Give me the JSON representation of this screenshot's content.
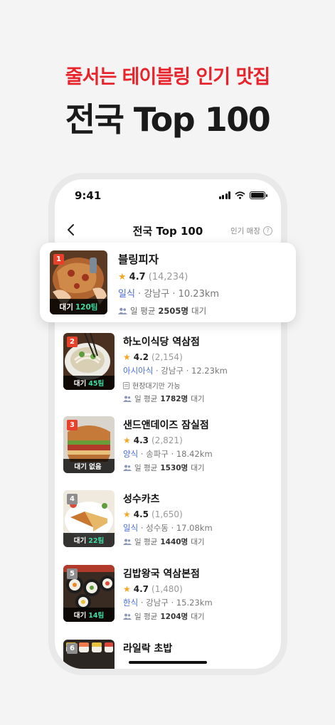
{
  "hero": {
    "subtitle": "줄서는 테이블링 인기 맛집",
    "title": "전국 Top 100"
  },
  "status_bar": {
    "time": "9:41"
  },
  "nav": {
    "title": "전국 Top 100",
    "right_label": "인기 매장",
    "help_glyph": "?"
  },
  "restaurants": [
    {
      "rank": "1",
      "name": "블링피자",
      "rating": "4.7",
      "review_count": "(14,234)",
      "category": "일식",
      "area": "강남구",
      "distance": "10.23km",
      "wait_prefix": "대기",
      "wait_count": "120팀",
      "avg_prefix": "일 평균",
      "avg_count": "2505명",
      "avg_suffix": "대기"
    },
    {
      "rank": "2",
      "name": "하노이식당 역삼점",
      "rating": "4.2",
      "review_count": "(2,154)",
      "category": "아시아식",
      "area": "강남구",
      "distance": "12.23km",
      "wait_prefix": "대기",
      "wait_count": "45팀",
      "onsite_note": "현장대기만 가능",
      "avg_prefix": "일 평균",
      "avg_count": "1782명",
      "avg_suffix": "대기"
    },
    {
      "rank": "3",
      "name": "샌드앤데이즈 잠실점",
      "rating": "4.3",
      "review_count": "(2,821)",
      "category": "양식",
      "area": "송파구",
      "distance": "18.42km",
      "wait_prefix": "대기 없음",
      "wait_count": "",
      "avg_prefix": "일 평균",
      "avg_count": "1530명",
      "avg_suffix": "대기"
    },
    {
      "rank": "4",
      "name": "성수카츠",
      "rating": "4.5",
      "review_count": "(1,650)",
      "category": "일식",
      "area": "성수동",
      "distance": "17.08km",
      "wait_prefix": "대기",
      "wait_count": "22팀",
      "avg_prefix": "일 평균",
      "avg_count": "1440명",
      "avg_suffix": "대기"
    },
    {
      "rank": "5",
      "name": "김밥왕국 역삼본점",
      "rating": "4.7",
      "review_count": "(1,480)",
      "category": "한식",
      "area": "강남구",
      "distance": "15.23km",
      "wait_prefix": "대기",
      "wait_count": "14팀",
      "avg_prefix": "일 평균",
      "avg_count": "1204명",
      "avg_suffix": "대기"
    },
    {
      "rank": "6",
      "name": "라일락 초밥"
    }
  ],
  "icons": {
    "back": "chevron-left-icon",
    "star": "star-icon",
    "people": "people-icon",
    "doc": "document-icon"
  },
  "colors": {
    "accent_red": "#e8232b",
    "wait_green": "#3fdca3",
    "category_blue": "#4a6fd6",
    "star_yellow": "#f5a623"
  }
}
